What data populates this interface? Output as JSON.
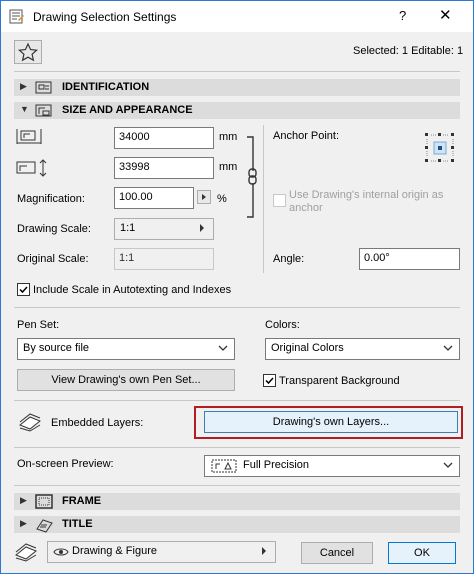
{
  "window": {
    "title": "Drawing Selection Settings",
    "help_glyph": "?",
    "close_glyph": "✕"
  },
  "header": {
    "selected_info": "Selected: 1 Editable: 1"
  },
  "sections": {
    "identification": "IDENTIFICATION",
    "size_appearance": "SIZE AND APPEARANCE",
    "frame": "FRAME",
    "title": "TITLE"
  },
  "size": {
    "width_value": "34000",
    "height_value": "33998",
    "unit": "mm",
    "magnification_label": "Magnification:",
    "magnification_value": "100.00",
    "percent": "%",
    "drawing_scale_label": "Drawing Scale:",
    "drawing_scale_value": "1:1",
    "original_scale_label": "Original Scale:",
    "original_scale_value": "1:1",
    "anchor_label": "Anchor Point:",
    "internal_origin_label": "Use Drawing's internal origin as anchor",
    "angle_label": "Angle:",
    "angle_value": "0.00°",
    "include_scale_label": "Include Scale in Autotexting and Indexes"
  },
  "pens": {
    "pen_set_label": "Pen Set:",
    "pen_set_value": "By source file",
    "colors_label": "Colors:",
    "colors_value": "Original Colors",
    "view_pen_set_button": "View Drawing's own Pen Set...",
    "transparent_label": "Transparent Background"
  },
  "layers": {
    "embedded_label": "Embedded Layers:",
    "own_layers_button": "Drawing's own Layers..."
  },
  "preview": {
    "label": "On-screen Preview:",
    "value": "Full Precision"
  },
  "footer": {
    "layer_value": "Drawing & Figure",
    "cancel": "Cancel",
    "ok": "OK"
  },
  "colors": {
    "accent": "#0078d7",
    "highlight_frame": "#b01e23"
  }
}
